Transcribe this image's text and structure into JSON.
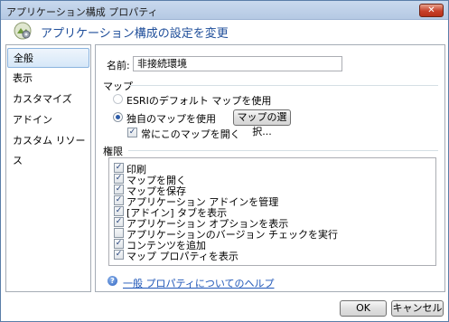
{
  "window": {
    "title": "アプリケーション構成 プロパティ",
    "close_label": "✕",
    "header_title": "アプリケーション構成の設定を変更"
  },
  "sidebar": {
    "items": [
      {
        "label": "全般",
        "selected": true
      },
      {
        "label": "表示",
        "selected": false
      },
      {
        "label": "カスタマイズ",
        "selected": false
      },
      {
        "label": "アドイン",
        "selected": false
      },
      {
        "label": "カスタム リソース",
        "selected": false
      }
    ]
  },
  "general": {
    "name_label": "名前:",
    "name_value": "非接続環境",
    "map_section": "マップ",
    "map_options": [
      {
        "label": "ESRIのデフォルト マップを使用",
        "selected": false
      },
      {
        "label": "独自のマップを使用",
        "selected": true
      }
    ],
    "select_map_button": "マップの選択...",
    "always_open_map": {
      "label": "常にこのマップを開く",
      "checked": true
    },
    "permissions_section": "権限",
    "permissions": [
      {
        "label": "印刷",
        "checked": true
      },
      {
        "label": "マップを開く",
        "checked": true
      },
      {
        "label": "マップを保存",
        "checked": true
      },
      {
        "label": "アプリケーション アドインを管理",
        "checked": true
      },
      {
        "label": "[アドイン] タブを表示",
        "checked": true
      },
      {
        "label": "アプリケーション オプションを表示",
        "checked": true
      },
      {
        "label": "アプリケーションのバージョン チェックを実行",
        "checked": false
      },
      {
        "label": "コンテンツを追加",
        "checked": true
      },
      {
        "label": "マップ プロパティを表示",
        "checked": true
      }
    ],
    "help_link": "一般 プロパティについてのヘルプ"
  },
  "footer": {
    "ok_label": "OK",
    "cancel_label": "キャンセル"
  }
}
